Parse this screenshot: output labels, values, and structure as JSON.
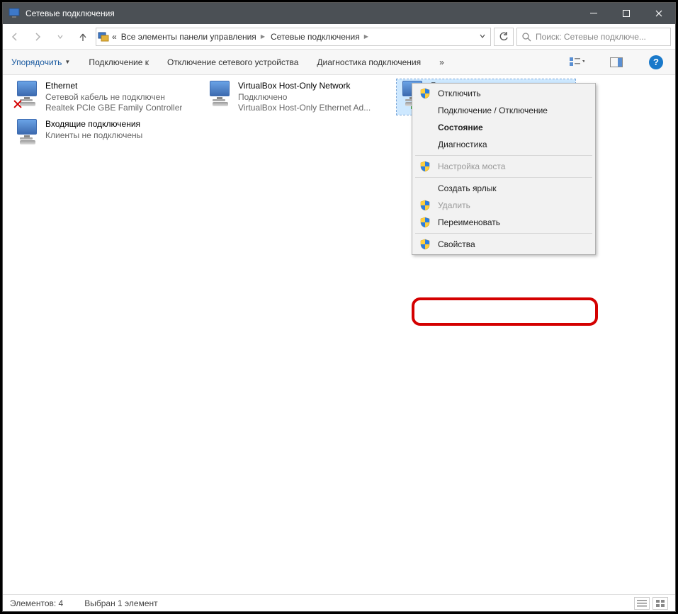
{
  "title": "Сетевые подключения",
  "breadcrumb": {
    "prefix": "«",
    "seg1": "Все элементы панели управления",
    "seg2": "Сетевые подключения"
  },
  "search_placeholder": "Поиск: Сетевые подключе...",
  "toolbar": {
    "organize": "Упорядочить",
    "connect_to": "Подключение к",
    "disable": "Отключение сетевого устройства",
    "diagnose": "Диагностика подключения",
    "overflow": "»"
  },
  "items": [
    {
      "title": "Ethernet",
      "sub1": "Сетевой кабель не подключен",
      "sub2": "Realtek PCIe GBE Family Controller",
      "icon": "disconnected"
    },
    {
      "title": "VirtualBox Host-Only Network",
      "sub1": "Подключено",
      "sub2": "VirtualBox Host-Only Ethernet Ad...",
      "icon": "connected"
    },
    {
      "title": "Беспроводная сеть",
      "sub1": "",
      "sub2": "",
      "icon": "wifi",
      "selected": true
    },
    {
      "title": "Входящие подключения",
      "sub1": "Клиенты не подключены",
      "sub2": "",
      "icon": "incoming"
    }
  ],
  "context_menu": [
    {
      "label": "Отключить",
      "shield": true
    },
    {
      "label": "Подключение / Отключение",
      "shield": false
    },
    {
      "label": "Состояние",
      "shield": false,
      "bold": true
    },
    {
      "label": "Диагностика",
      "shield": false
    },
    {
      "sep": true
    },
    {
      "label": "Настройка моста",
      "shield": true,
      "disabled": true
    },
    {
      "sep": true
    },
    {
      "label": "Создать ярлык",
      "shield": false
    },
    {
      "label": "Удалить",
      "shield": true,
      "disabled": true
    },
    {
      "label": "Переименовать",
      "shield": true
    },
    {
      "sep": true
    },
    {
      "label": "Свойства",
      "shield": true
    }
  ],
  "statusbar": {
    "count_label": "Элементов: 4",
    "selection_label": "Выбран 1 элемент"
  }
}
